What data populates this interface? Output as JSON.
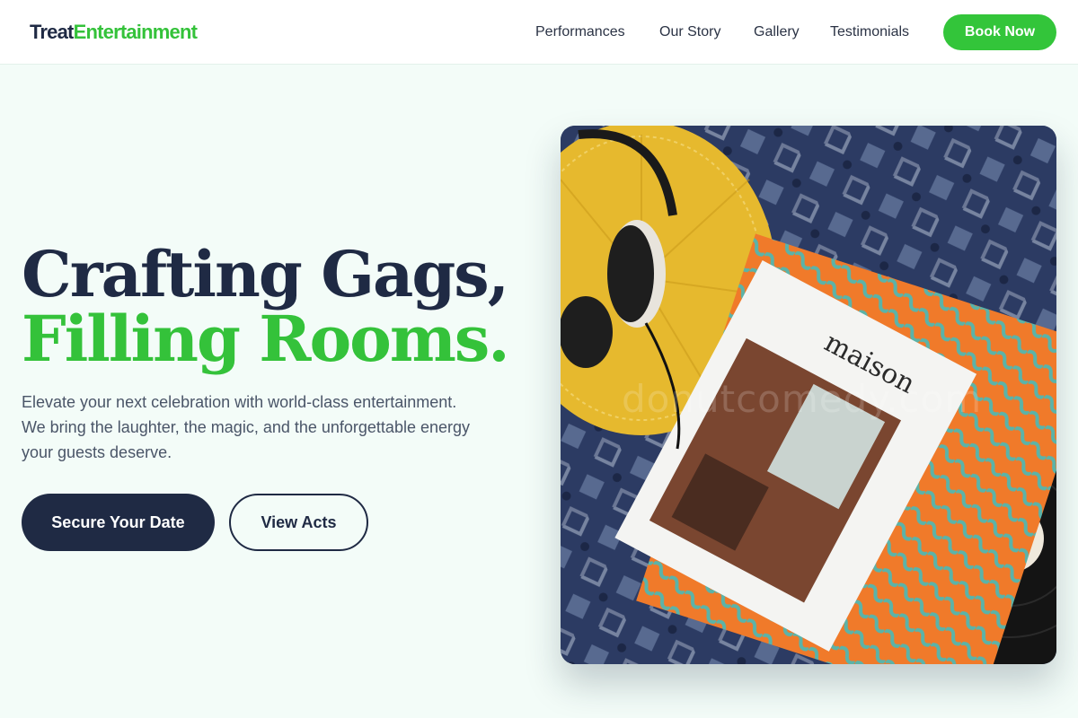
{
  "brand": {
    "part1": "Treat",
    "part2": "Entertainment",
    "accent_color": "#34c23a",
    "dark_color": "#1f2a44"
  },
  "nav": {
    "items": [
      {
        "label": "Performances"
      },
      {
        "label": "Our Story"
      },
      {
        "label": "Gallery"
      },
      {
        "label": "Testimonials"
      }
    ],
    "cta_label": "Book Now"
  },
  "hero": {
    "title_line1": "Crafting Gags,",
    "title_line2": "Filling Rooms.",
    "description": "Elevate your next celebration with world-class entertainment. We bring the laughter, the magic, and the unforgettable energy your guests deserve.",
    "primary_button": "Secure Your Date",
    "secondary_button": "View Acts"
  },
  "image": {
    "magazine_title": "maison",
    "watermark": "donutcomedy.com"
  }
}
